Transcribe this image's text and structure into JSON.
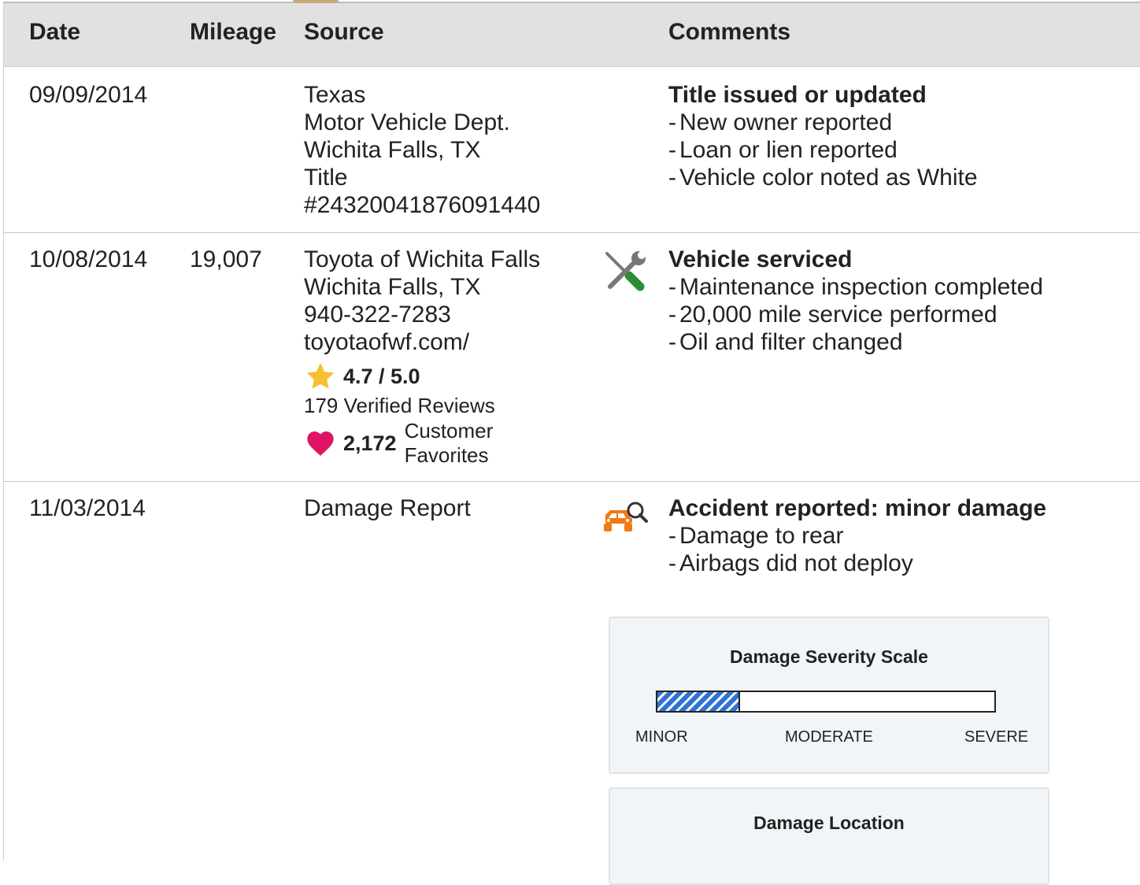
{
  "header": {
    "date": "Date",
    "mileage": "Mileage",
    "source": "Source",
    "comments": "Comments"
  },
  "rows": [
    {
      "date": "09/09/2014",
      "mileage": "",
      "source": [
        "Texas",
        "Motor Vehicle Dept.",
        "Wichita Falls, TX",
        "Title",
        "#24320041876091440"
      ],
      "icon": "",
      "comment_title": "Title issued or updated",
      "comment_lines": [
        "New owner reported",
        "Loan or lien reported",
        "Vehicle color noted as White"
      ]
    },
    {
      "date": "10/08/2014",
      "mileage": "19,007",
      "source": [
        "Toyota of Wichita Falls",
        "Wichita Falls, TX",
        "940-322-7283",
        "toyotaofwf.com/"
      ],
      "rating": "4.7 / 5.0",
      "reviews": "179 Verified Reviews",
      "favorites_count": "2,172",
      "favorites_label_1": "Customer",
      "favorites_label_2": "Favorites",
      "icon": "wrench-screwdriver-icon",
      "comment_title": "Vehicle serviced",
      "comment_lines": [
        "Maintenance inspection completed",
        "20,000 mile service performed",
        "Oil and filter changed"
      ]
    },
    {
      "date": "11/03/2014",
      "mileage": "",
      "source": [
        "Damage Report"
      ],
      "icon": "car-damage-search-icon",
      "comment_title": "Accident reported: minor damage",
      "comment_lines": [
        "Damage to rear",
        "Airbags did not deploy"
      ]
    }
  ],
  "severity_panel": {
    "title": "Damage Severity Scale",
    "level_fraction": 0.24,
    "labels": [
      "MINOR",
      "MODERATE",
      "SEVERE"
    ]
  },
  "location_panel": {
    "title": "Damage Location"
  },
  "colors": {
    "header_bg": "#e1e1e1",
    "star": "#f6c02e",
    "heart": "#de1466",
    "accident_icon": "#f07a12",
    "service_icon_handle": "#2e8b36",
    "scale_fill": "#2f74d4"
  }
}
